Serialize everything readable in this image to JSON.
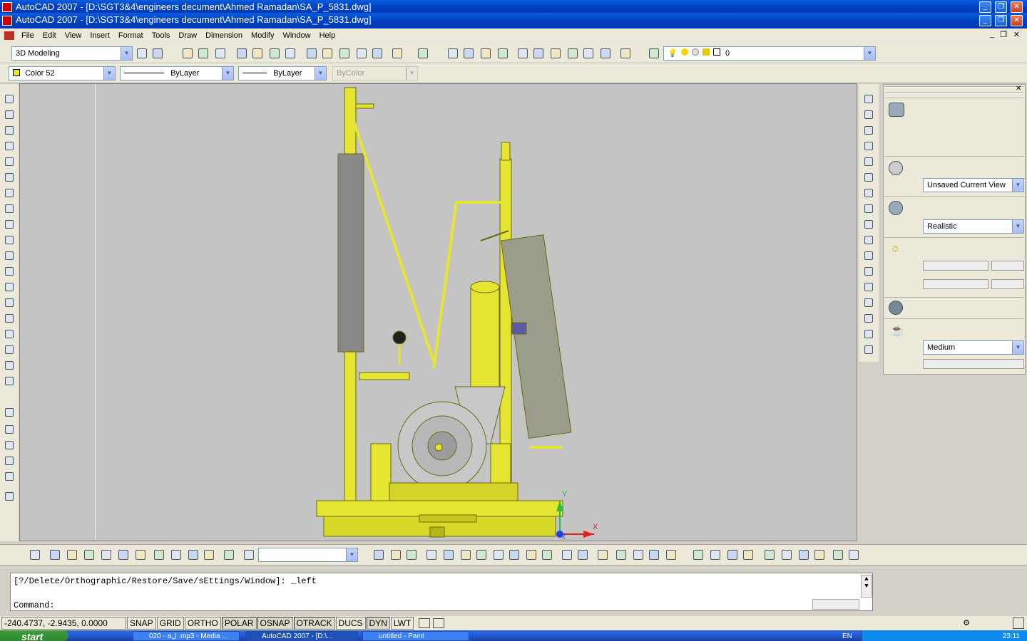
{
  "window": {
    "outer_title": "AutoCAD 2007 - [D:\\SGT3&4\\engineers decument\\Ahmed Ramadan\\SA_P_5831.dwg]",
    "title": "AutoCAD 2007 - [D:\\SGT3&4\\engineers decument\\Ahmed Ramadan\\SA_P_5831.dwg]",
    "min": "_",
    "max": "□",
    "close": "×"
  },
  "menu": [
    "File",
    "Edit",
    "View",
    "Insert",
    "Format",
    "Tools",
    "Draw",
    "Dimension",
    "Modify",
    "Window",
    "Help"
  ],
  "toolbar1": {
    "workspace": "3D Modeling",
    "layer": "0"
  },
  "properties": {
    "color": "Color 52",
    "linetype": "ByLayer",
    "lineweight": "ByLayer",
    "plotstyle": "ByColor"
  },
  "dashboard": {
    "view": "Unsaved Current View",
    "visual_style": "Realistic",
    "render_quality": "Medium"
  },
  "axis": {
    "x": "X",
    "y": "Y",
    "z": "Z"
  },
  "command": {
    "history": "[?/Delete/Orthographic/Restore/Save/sEttings/Window]: _left",
    "prompt": "Command:"
  },
  "status": {
    "coords": "-240.4737, -2.9435, 0.0000",
    "buttons": [
      "SNAP",
      "GRID",
      "ORTHO",
      "POLAR",
      "OSNAP",
      "OTRACK",
      "DUCS",
      "DYN",
      "LWT"
    ],
    "on": [
      "POLAR",
      "OSNAP",
      "OTRACK",
      "DYN"
    ]
  },
  "taskbar": {
    "start": "start",
    "tasks": [
      "020 - aل .mp3 - Media ...",
      "AutoCAD 2007 - [D:\\...",
      "untitled - Paint"
    ],
    "lang": "EN",
    "time": "23:11"
  },
  "colors": {
    "model": "#e5e531",
    "model_dark": "#b5b516",
    "viewport": "#c4c4c4",
    "xp_blue": "#0a5ddd"
  }
}
